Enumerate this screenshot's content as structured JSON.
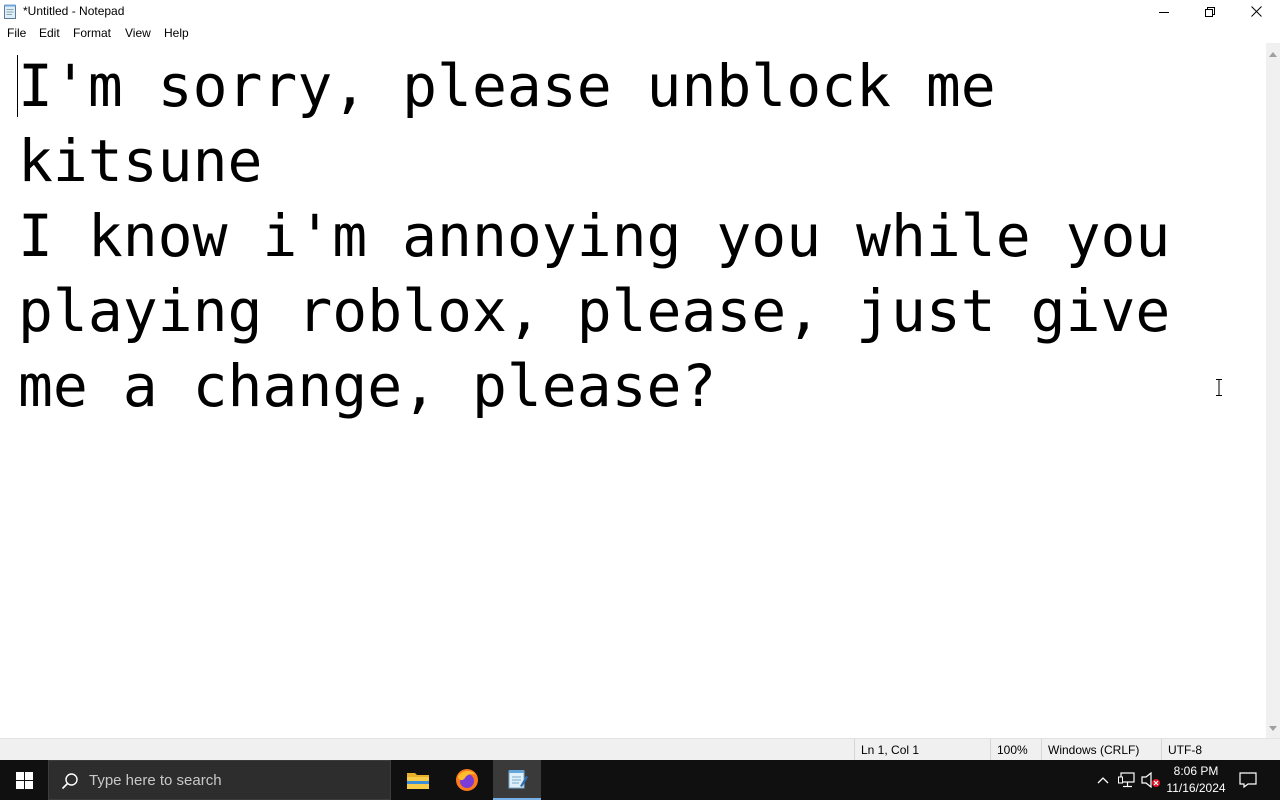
{
  "window": {
    "title": "*Untitled - Notepad",
    "controls": [
      "minimize",
      "restore",
      "close"
    ]
  },
  "menu": {
    "items": [
      "File",
      "Edit",
      "Format",
      "View",
      "Help"
    ]
  },
  "editor": {
    "text": "I'm sorry, please unblock me kitsune\nI know i'm annoying you while you playing roblox, please, just give me a change, please?"
  },
  "status": {
    "position": "Ln 1, Col 1",
    "zoom": "100%",
    "line_ending": "Windows (CRLF)",
    "encoding": "UTF-8"
  },
  "taskbar": {
    "search_placeholder": "Type here to search",
    "pinned": [
      "file-explorer",
      "firefox",
      "notepad"
    ],
    "active_app": "notepad"
  },
  "clock": {
    "time": "8:06 PM",
    "date": "11/16/2024"
  },
  "colors": {
    "taskbar_bg": "#101010",
    "search_bg": "#2d2d2d",
    "active_indicator": "#77b0e8",
    "status_bg": "#f0f0f0"
  }
}
